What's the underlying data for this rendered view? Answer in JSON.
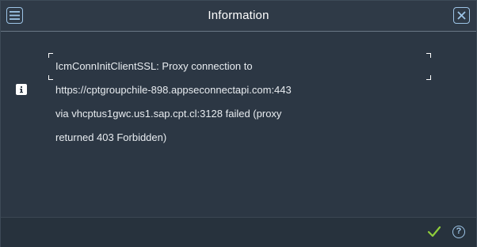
{
  "header": {
    "title": "Information",
    "menu_icon": "hamburger-menu-icon",
    "close_icon": "close-icon"
  },
  "message": {
    "icon": "info-icon",
    "lines": [
      "IcmConnInitClientSSL: Proxy connection to",
      "https://cptgroupchile-898.appseconnectapi.com:443",
      "via vhcptus1gwc.us1.sap.cpt.cl:3128 failed (proxy",
      "returned 403 Forbidden)"
    ]
  },
  "footer": {
    "ok_icon": "checkmark-icon",
    "help_label": "?"
  },
  "colors": {
    "background": "#2c3744",
    "accent": "#9dc4e6",
    "ok_green": "#8fce3b",
    "text": "#e8ecf0"
  }
}
